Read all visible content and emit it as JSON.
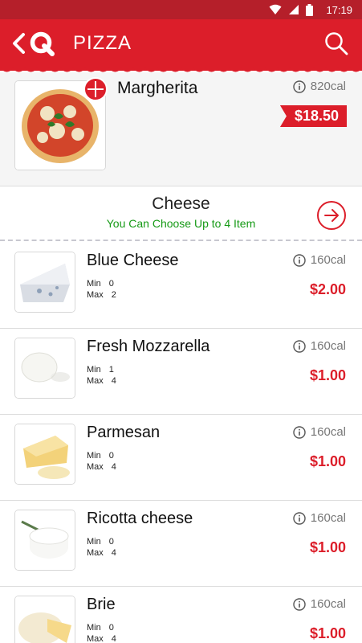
{
  "status_bar": {
    "time": "17:19"
  },
  "app_bar": {
    "title": "PIZZA"
  },
  "main_item": {
    "name": "Margherita",
    "calories": "820cal",
    "price": "$18.50"
  },
  "group": {
    "title": "Cheese",
    "subtitle": "You Can Choose Up to 4 Item"
  },
  "options": [
    {
      "name": "Blue Cheese",
      "calories": "160cal",
      "min_label": "Min",
      "min": "0",
      "max_label": "Max",
      "max": "2",
      "price": "$2.00"
    },
    {
      "name": "Fresh Mozzarella",
      "calories": "160cal",
      "min_label": "Min",
      "min": "1",
      "max_label": "Max",
      "max": "4",
      "price": "$1.00"
    },
    {
      "name": "Parmesan",
      "calories": "160cal",
      "min_label": "Min",
      "min": "0",
      "max_label": "Max",
      "max": "4",
      "price": "$1.00"
    },
    {
      "name": "Ricotta cheese",
      "calories": "160cal",
      "min_label": "Min",
      "min": "0",
      "max_label": "Max",
      "max": "4",
      "price": "$1.00"
    },
    {
      "name": "Brie",
      "calories": "160cal",
      "min_label": "Min",
      "min": "0",
      "max_label": "Max",
      "max": "4",
      "price": "$1.00"
    }
  ],
  "colors": {
    "primary": "#dc1e2a",
    "status_bar": "#b51f2a",
    "accent_green": "#169a16",
    "price_red": "#dc1e2a"
  },
  "icons": [
    "wifi-icon",
    "signal-icon",
    "battery-icon",
    "back-icon",
    "app-logo-icon",
    "search-icon",
    "add-icon",
    "info-icon",
    "arrow-right-circle-icon"
  ]
}
